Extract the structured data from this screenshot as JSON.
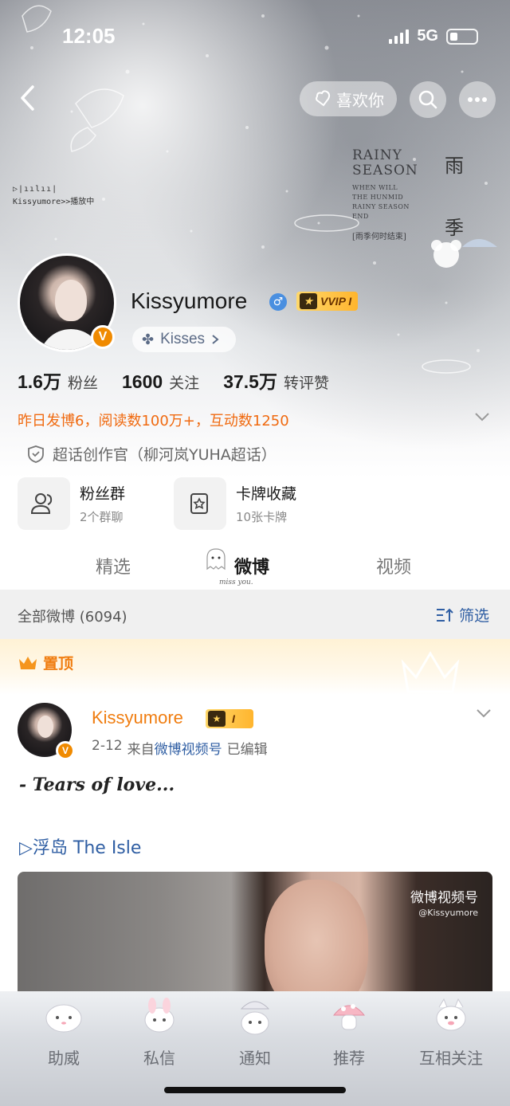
{
  "status_bar": {
    "time": "12:05",
    "network": "5G"
  },
  "header": {
    "like_label": "喜欢你"
  },
  "banner": {
    "music_text": "Kissyumore>>播放中",
    "rainy_title_1": "RAINY",
    "rainy_title_2": "SEASON",
    "rainy_lines": [
      "WHEN WILL",
      "THE HUNMID",
      "RAINY SEASON",
      "END"
    ],
    "rainy_caption": "[雨季何时结束]",
    "char_1": "雨",
    "char_2": "季"
  },
  "profile": {
    "name": "Kissyumore",
    "gender_symbol": "♂",
    "vip_label": "VVIP I",
    "fan_club": "Kisses",
    "stats": [
      {
        "num": "1.6万",
        "label": "粉丝"
      },
      {
        "num": "1600",
        "label": "关注"
      },
      {
        "num": "37.5万",
        "label": "转评赞"
      }
    ],
    "activity": "昨日发博6，阅读数100万+，互动数1250",
    "creator": "超话创作官（柳河岚YUHA超话）"
  },
  "cards": [
    {
      "title": "粉丝群",
      "sub": "2个群聊"
    },
    {
      "title": "卡牌收藏",
      "sub": "10张卡牌"
    }
  ],
  "tabs": [
    "精选",
    "微博",
    "视频"
  ],
  "tab_decoration": "miss you.",
  "filter": {
    "all_label": "全部微博 (6094)",
    "filter_label": "筛选"
  },
  "pinned_label": "置顶",
  "post": {
    "author": "Kissyumore",
    "vip_level": "I",
    "date": "2-12",
    "from_prefix": "来自",
    "source": "微博视频号",
    "edited": "已编辑",
    "text": "- Tears of love...",
    "link": "▷浮岛 The Isle",
    "watermark": "微博视频号",
    "watermark_handle": "@Kissyumore"
  },
  "bottom_nav": [
    "助威",
    "私信",
    "通知",
    "推荐",
    "互相关注"
  ]
}
